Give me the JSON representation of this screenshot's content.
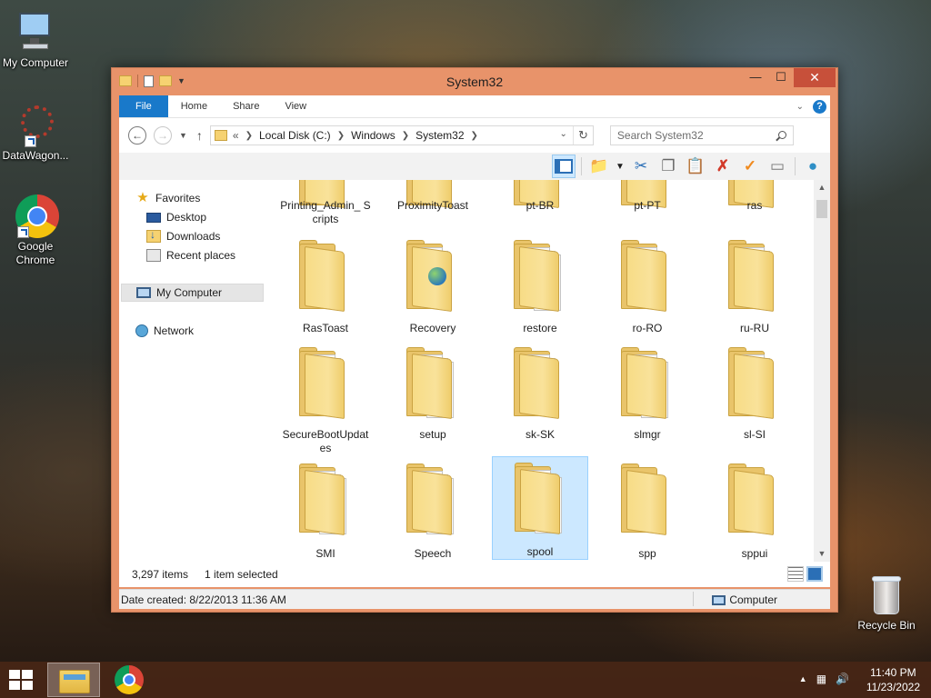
{
  "desktop": {
    "icons": [
      {
        "label": "My Computer"
      },
      {
        "label": "DataWagon..."
      },
      {
        "label": "Google Chrome"
      },
      {
        "label": "Recycle Bin"
      }
    ]
  },
  "window": {
    "title": "System32",
    "ribbon_tabs": [
      "File",
      "Home",
      "Share",
      "View"
    ],
    "address": {
      "overflow": "«",
      "crumbs": [
        "Local Disk (C:)",
        "Windows",
        "System32"
      ]
    },
    "search": {
      "placeholder": "Search System32"
    },
    "nav": {
      "favorites": "Favorites",
      "desktop": "Desktop",
      "downloads": "Downloads",
      "recent": "Recent places",
      "computer": "My Computer",
      "network": "Network"
    },
    "folders": [
      {
        "name": "Printing_Admin_ Scripts"
      },
      {
        "name": "ProximityToast"
      },
      {
        "name": "pt-BR"
      },
      {
        "name": "pt-PT"
      },
      {
        "name": "ras"
      },
      {
        "name": "RasToast"
      },
      {
        "name": "Recovery"
      },
      {
        "name": "restore"
      },
      {
        "name": "ro-RO"
      },
      {
        "name": "ru-RU"
      },
      {
        "name": "SecureBootUpdat es"
      },
      {
        "name": "setup"
      },
      {
        "name": "sk-SK"
      },
      {
        "name": "slmgr"
      },
      {
        "name": "sl-SI"
      },
      {
        "name": "SMI"
      },
      {
        "name": "Speech"
      },
      {
        "name": "spool",
        "selected": true
      },
      {
        "name": "spp"
      },
      {
        "name": "sppui"
      }
    ],
    "status": {
      "item_count": "3,297 items",
      "selection": "1 item selected"
    },
    "details": {
      "date_created": "Date created: 8/22/2013 11:36 AM",
      "location": "Computer"
    }
  },
  "taskbar": {
    "time": "11:40 PM",
    "date": "11/23/2022"
  },
  "colors": {
    "titlebar": "#e8936a",
    "accent": "#1979ca",
    "selection": "#cce8ff"
  }
}
